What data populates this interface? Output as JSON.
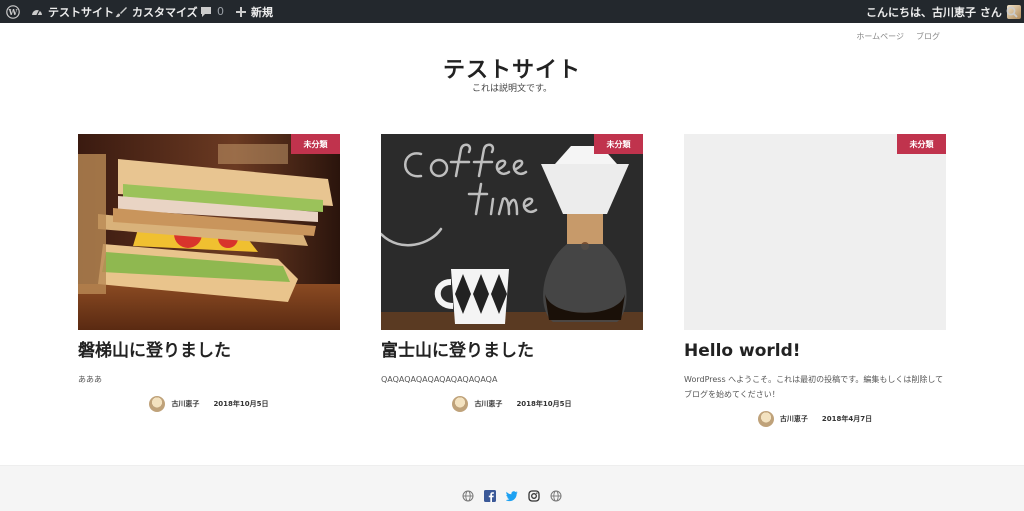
{
  "adminbar": {
    "site_label": "テストサイト",
    "customize_label": "カスタマイズ",
    "comments_count": "0",
    "new_label": "新規",
    "greeting": "こんにちは、古川恵子 さん"
  },
  "nav": {
    "items": [
      "ホームページ",
      "ブログ"
    ]
  },
  "header": {
    "title": "テストサイト",
    "description": "これは説明文です。"
  },
  "posts": [
    {
      "category": "未分類",
      "title": "磐梯山に登りました",
      "excerpt": "あああ",
      "author": "古川恵子",
      "date": "2018年10月5日",
      "image": "sandwich-photo"
    },
    {
      "category": "未分類",
      "title": "富士山に登りました",
      "excerpt": "QAQAQAQAQAQAQAQAQAQA",
      "author": "古川恵子",
      "date": "2018年10月5日",
      "image": "coffee-photo"
    },
    {
      "category": "未分類",
      "title": "Hello world!",
      "excerpt": "WordPress へようこそ。これは最初の投稿です。編集もしくは削除してブログを始めてください！",
      "author": "古川恵子",
      "date": "2018年4月7日",
      "image": "none"
    }
  ],
  "footer": {
    "social_icons": [
      "globe-icon",
      "facebook-icon",
      "twitter-icon",
      "instagram-icon",
      "globe-icon"
    ]
  },
  "colors": {
    "adminbar": "#23282d",
    "badge": "#c0334d",
    "twitter": "#1da1f2",
    "facebook": "#3b5998"
  }
}
